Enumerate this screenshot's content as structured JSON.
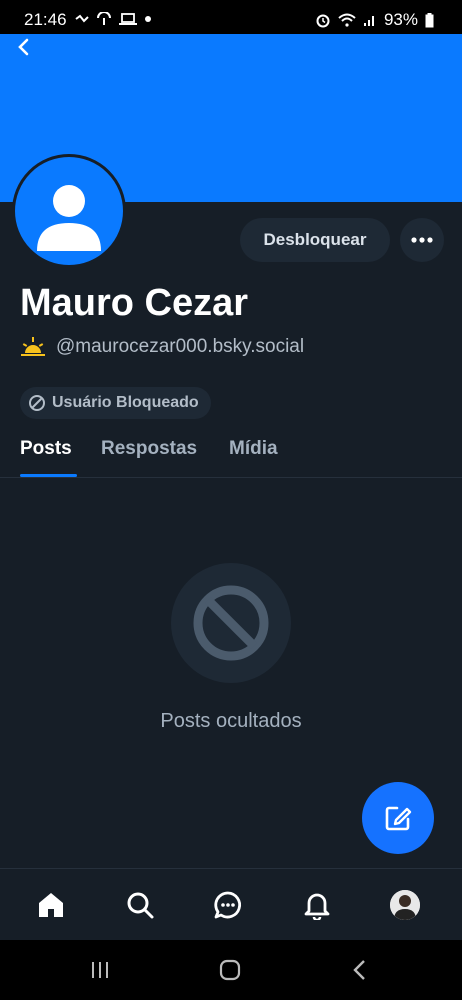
{
  "status_bar": {
    "time": "21:46",
    "battery": "93%"
  },
  "profile": {
    "display_name": "Mauro Cezar",
    "handle": "@maurocezar000.bsky.social",
    "blocked_label": "Usuário Bloqueado",
    "unblock_label": "Desbloquear",
    "banner_color": "#0a7aff"
  },
  "tabs": [
    {
      "label": "Posts",
      "active": true
    },
    {
      "label": "Respostas",
      "active": false
    },
    {
      "label": "Mídia",
      "active": false
    }
  ],
  "empty_state": {
    "label": "Posts ocultados",
    "icon": "block-icon"
  },
  "bottom_nav": [
    "home-icon",
    "search-icon",
    "chat-icon",
    "bell-icon",
    "avatar"
  ],
  "colors": {
    "accent": "#0a7aff",
    "background": "#161e27",
    "surface": "#1e2935"
  }
}
